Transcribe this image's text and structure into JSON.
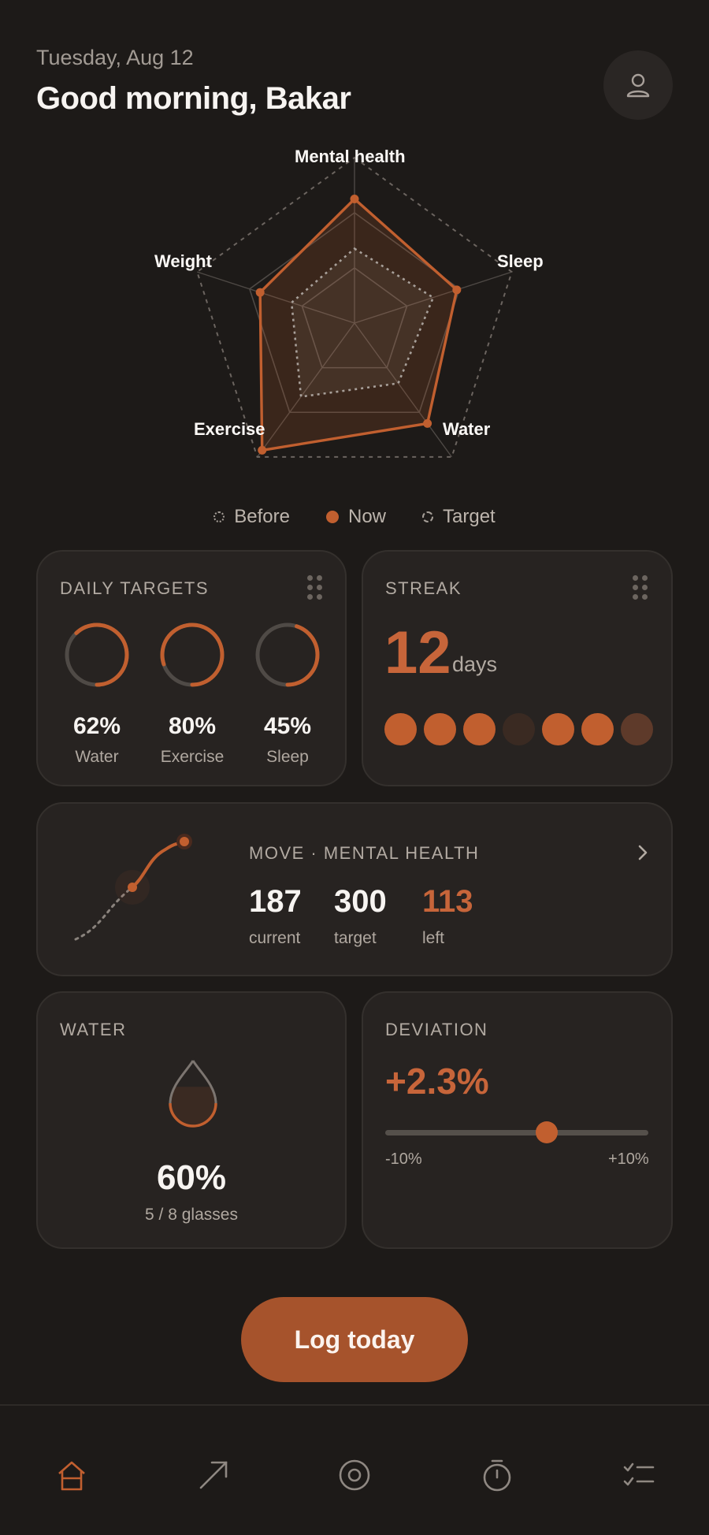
{
  "header": {
    "date": "Tuesday, Aug 12",
    "greeting": "Good morning, Bakar",
    "avatar_icon": "user-icon"
  },
  "chart_data": {
    "type": "radar",
    "axes": [
      "Mental health",
      "Sleep",
      "Water",
      "Exercise",
      "Weight"
    ],
    "series": [
      {
        "name": "Before",
        "values": [
          0.45,
          0.5,
          0.45,
          0.55,
          0.4
        ]
      },
      {
        "name": "Now",
        "values": [
          0.75,
          0.65,
          0.75,
          0.95,
          0.6
        ]
      },
      {
        "name": "Target",
        "values": [
          1,
          1,
          1,
          1,
          1
        ]
      }
    ],
    "grid_levels": 3
  },
  "radar_labels": {
    "mental": "Mental health",
    "sleep": "Sleep",
    "water": "Water",
    "exercise": "Exercise",
    "weight": "Weight"
  },
  "legend": {
    "before": "Before",
    "now": "Now",
    "target": "Target"
  },
  "daily_targets": {
    "title": "DAILY TARGETS",
    "rings": [
      {
        "value": "62%",
        "label": "Water",
        "progress": 0.62
      },
      {
        "value": "80%",
        "label": "Exercise",
        "progress": 0.8
      },
      {
        "value": "45%",
        "label": "Sleep",
        "progress": 0.45
      }
    ]
  },
  "streak": {
    "title": "STREAK",
    "count": "12",
    "unit": "days",
    "days": [
      "full",
      "full",
      "full",
      "dim",
      "full",
      "full",
      "half"
    ]
  },
  "move": {
    "title": "MOVE · MENTAL HEALTH",
    "current": "187",
    "current_label": "current",
    "target": "300",
    "target_label": "target",
    "left": "113",
    "left_label": "left"
  },
  "water": {
    "title": "WATER",
    "percent": "60%",
    "glasses": "5 / 8 glasses",
    "fill": 0.6
  },
  "deviation": {
    "title": "DEVIATION",
    "value": "+2.3%",
    "min_label": "-10%",
    "max_label": "+10%",
    "position": 0.615
  },
  "cta": {
    "label": "Log today"
  },
  "nav": {
    "items": [
      "home-icon",
      "trend-icon",
      "target-icon",
      "timer-icon",
      "checklist-icon"
    ],
    "active": 0
  },
  "colors": {
    "accent": "#c15f2f",
    "background": "#1d1a18",
    "card": "#272321"
  }
}
